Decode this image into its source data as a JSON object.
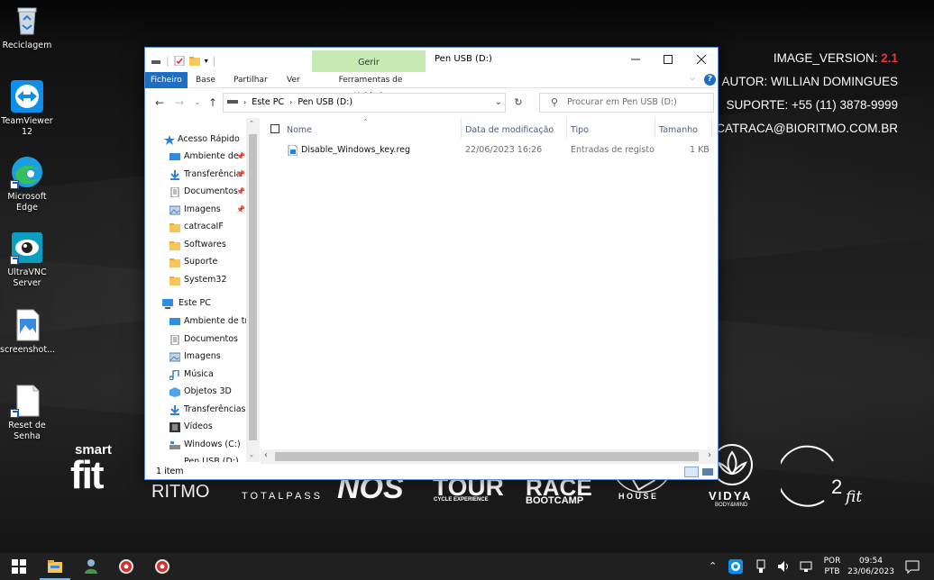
{
  "desktop": {
    "icons": [
      {
        "label": "Reciclagem",
        "icon": "recycle-bin-icon"
      },
      {
        "label": "TeamViewer 12",
        "icon": "teamviewer-icon"
      },
      {
        "label": "Microsoft Edge",
        "icon": "edge-icon"
      },
      {
        "label": "UltraVNC Server",
        "icon": "ultravnc-icon"
      },
      {
        "label": "screenshot...",
        "icon": "image-file-icon"
      },
      {
        "label": "Reset de Senha",
        "icon": "document-file-icon"
      }
    ],
    "info": {
      "image_version_label": "IMAGE_VERSION:",
      "image_version_value": "2.1",
      "author": "AUTOR: WILLIAN DOMINGUES",
      "support": "SUPORTE: +55 (11) 3878-9999",
      "email": "CATRACA@BIORITMO.COM.BR"
    },
    "brands": {
      "smartfit_top": "smart",
      "smartfit_bottom": "fit",
      "bioritmo": "RITMO",
      "totalpass": "TOTALPASS",
      "nos": "NOS",
      "tour": "TOUR",
      "tour_sub": "CYCLE EXPERIENCE",
      "race": "RACE",
      "race_sub": "BOOTCAMP",
      "house": "H O U S E",
      "vidya": "VIDYA",
      "vidya_sub": "BODY&MIND",
      "o2": "2",
      "o2_sub": "fit"
    },
    "colors": {
      "accent_red": "#e3393b",
      "explorer_blue": "#1c6ec6",
      "context_green": "#c7eab4"
    }
  },
  "explorer": {
    "title": "Pen USB (D:)",
    "context_group": "Gerir",
    "ribbon_tabs": [
      "Ficheiro",
      "Base",
      "Partilhar",
      "Ver",
      "Ferramentas de Unidade"
    ],
    "breadcrumb": [
      "Este PC",
      "Pen USB (D:)"
    ],
    "search_placeholder": "Procurar em Pen USB (D:)",
    "nav": {
      "quick_access": "Acesso Rápido",
      "quick_items": [
        "Ambiente de",
        "Transferência",
        "Documentos",
        "Imagens",
        "catracaIF",
        "Softwares",
        "Suporte",
        "System32"
      ],
      "this_pc": "Este PC",
      "pc_items": [
        "Ambiente de tra",
        "Documentos",
        "Imagens",
        "Música",
        "Objetos 3D",
        "Transferências",
        "Vídeos",
        "Windows (C:)",
        "Pen USB (D:)"
      ]
    },
    "columns": {
      "name": "Nome",
      "date": "Data de modificação",
      "type": "Tipo",
      "size": "Tamanho"
    },
    "files": [
      {
        "name": "Disable_Windows_key.reg",
        "date": "22/06/2023 16:26",
        "type": "Entradas de registo",
        "size": "1 KB",
        "icon": "reg-file-icon"
      }
    ],
    "status": "1 item"
  },
  "taskbar": {
    "lang_top": "POR",
    "lang_bottom": "PTB",
    "time": "09:54",
    "date": "23/06/2023"
  }
}
